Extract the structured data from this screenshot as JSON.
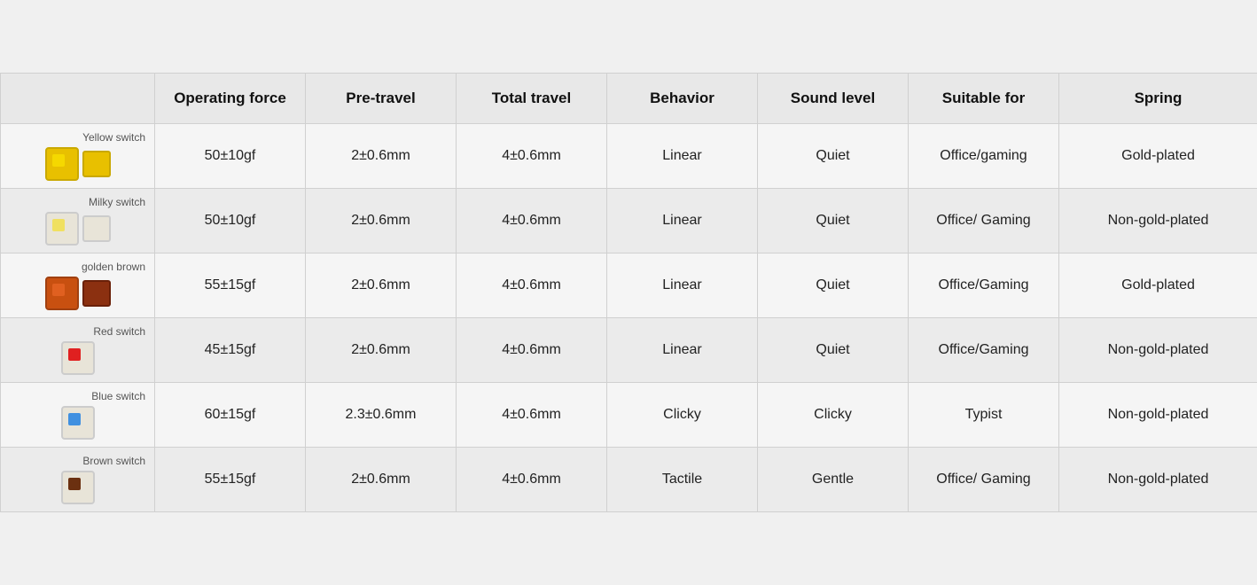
{
  "header": {
    "col_switch": "",
    "col_op": "Operating force",
    "col_pre": "Pre-travel",
    "col_total": "Total travel",
    "col_behav": "Behavior",
    "col_sound": "Sound level",
    "col_suit": "Suitable for",
    "col_spring": "Spring"
  },
  "rows": [
    {
      "switch_name": "Yellow switch",
      "op": "50±10gf",
      "pre": "2±0.6mm",
      "total": "4±0.6mm",
      "behavior": "Linear",
      "sound": "Quiet",
      "suitable": "Office/gaming",
      "spring": "Gold-plated",
      "switch_type": "yellow"
    },
    {
      "switch_name": "Milky switch",
      "op": "50±10gf",
      "pre": "2±0.6mm",
      "total": "4±0.6mm",
      "behavior": "Linear",
      "sound": "Quiet",
      "suitable": "Office/ Gaming",
      "spring": "Non-gold-plated",
      "switch_type": "milky"
    },
    {
      "switch_name": "golden brown",
      "op": "55±15gf",
      "pre": "2±0.6mm",
      "total": "4±0.6mm",
      "behavior": "Linear",
      "sound": "Quiet",
      "suitable": "Office/Gaming",
      "spring": "Gold-plated",
      "switch_type": "golden"
    },
    {
      "switch_name": "Red switch",
      "op": "45±15gf",
      "pre": "2±0.6mm",
      "total": "4±0.6mm",
      "behavior": "Linear",
      "sound": "Quiet",
      "suitable": "Office/Gaming",
      "spring": "Non-gold-plated",
      "switch_type": "red"
    },
    {
      "switch_name": "Blue switch",
      "op": "60±15gf",
      "pre": "2.3±0.6mm",
      "total": "4±0.6mm",
      "behavior": "Clicky",
      "sound": "Clicky",
      "suitable": "Typist",
      "spring": "Non-gold-plated",
      "switch_type": "blue"
    },
    {
      "switch_name": "Brown switch",
      "op": "55±15gf",
      "pre": "2±0.6mm",
      "total": "4±0.6mm",
      "behavior": "Tactile",
      "sound": "Gentle",
      "suitable": "Office/ Gaming",
      "spring": "Non-gold-plated",
      "switch_type": "brown"
    }
  ]
}
